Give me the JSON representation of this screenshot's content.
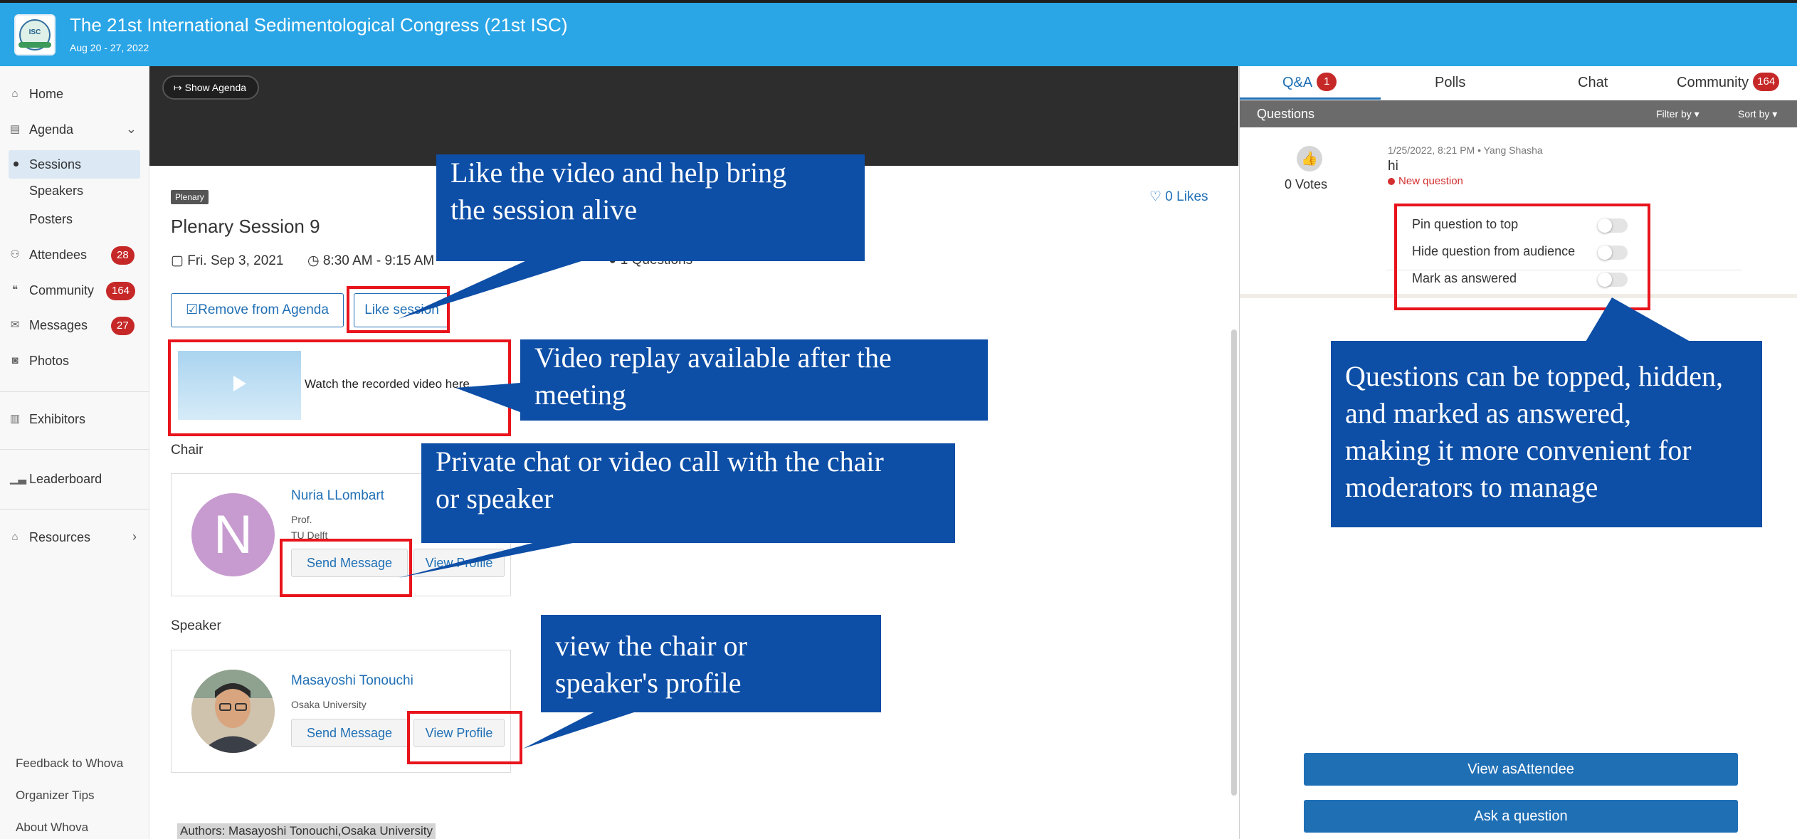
{
  "header": {
    "title": "The 21st International Sedimentological Congress (21st ISC)",
    "dates": "Aug 20 - 27, 2022",
    "logo_text": "ISC"
  },
  "sidebar": {
    "items": [
      {
        "label": "Home",
        "icon": "home-icon"
      },
      {
        "label": "Agenda",
        "icon": "calendar-icon",
        "chevron": "⌄"
      },
      {
        "label": "Sessions"
      },
      {
        "label": "Speakers"
      },
      {
        "label": "Posters"
      },
      {
        "label": "Attendees",
        "icon": "people-icon",
        "badge": "28"
      },
      {
        "label": "Community",
        "icon": "chat-bubbles-icon",
        "badge": "164"
      },
      {
        "label": "Messages",
        "icon": "envelope-icon",
        "badge": "27"
      },
      {
        "label": "Photos",
        "icon": "camera-icon"
      },
      {
        "label": "Exhibitors",
        "icon": "building-icon"
      },
      {
        "label": "Leaderboard",
        "icon": "leaderboard-icon"
      },
      {
        "label": "Resources",
        "icon": "bank-icon",
        "chevron": "›"
      }
    ],
    "footer": [
      "Feedback to Whova",
      "Organizer Tips",
      "About Whova"
    ]
  },
  "session": {
    "show_agenda": "Show Agenda",
    "tag": "Plenary",
    "title": "Plenary Session 9",
    "likes": "♡ 0 Likes",
    "date": "Fri. Sep 3, 2021",
    "time": "8:30 AM - 9:15 AM",
    "questions": "1 Questions",
    "remove_button": "Remove from Agenda",
    "like_button": "Like session",
    "video_text": "Watch the recorded video here"
  },
  "chair": {
    "heading": "Chair",
    "avatar_letter": "N",
    "name": "Nuria LLombart",
    "title": "Prof.",
    "org": "TU Delft",
    "send_message": "Send Message",
    "view_profile": "View Profile"
  },
  "speaker": {
    "heading": "Speaker",
    "name": "Masayoshi Tonouchi",
    "org": "Osaka University",
    "send_message": "Send Message",
    "view_profile": "View Profile"
  },
  "authors": "Authors: Masayoshi Tonouchi,Osaka University",
  "right_panel": {
    "tabs": [
      {
        "label": "Q&A",
        "badge": "1"
      },
      {
        "label": "Polls"
      },
      {
        "label": "Chat"
      },
      {
        "label": "Community",
        "badge": "164"
      }
    ],
    "bar_label": "Questions",
    "filter_label": "Filter by ▾",
    "sort_label": "Sort by ▾",
    "question": {
      "votes": "0  Votes",
      "meta": "1/25/2022, 8:21 PM • Yang Shasha",
      "text": "hi",
      "status": "New question"
    },
    "toggles": [
      "Pin question to top",
      "Hide question from audience",
      "Mark as answered"
    ],
    "view_as_attendee": "View asAttendee",
    "ask_question": "Ask a question"
  },
  "callouts": {
    "like": [
      "Like the video and help bring",
      "the session  alive"
    ],
    "video": [
      "Video replay available after the",
      "meeting"
    ],
    "chat": [
      "Private chat or video call with the chair",
      "or speaker"
    ],
    "profile": [
      "view the chair or",
      "speaker's profile"
    ],
    "questions": [
      "Questions can be topped, hidden,",
      "and marked as answered,",
      "making it more convenient for",
      "moderators to manage"
    ]
  },
  "colors": {
    "header": "#2aa5e6",
    "accent": "#1f6fb5",
    "badge": "#c62828",
    "callout": "#0d4ea6",
    "highlight": "#e8141c"
  }
}
